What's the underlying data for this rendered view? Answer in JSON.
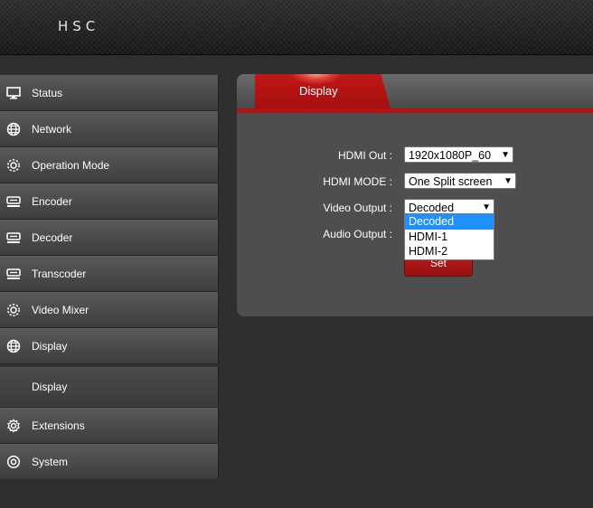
{
  "header": {
    "brand": "HSC"
  },
  "sidebar": {
    "items": [
      {
        "label": "Status",
        "icon": "monitor-icon"
      },
      {
        "label": "Network",
        "icon": "globe-icon"
      },
      {
        "label": "Operation Mode",
        "icon": "gear-icon"
      },
      {
        "label": "Encoder",
        "icon": "encoder-device-icon"
      },
      {
        "label": "Decoder",
        "icon": "decoder-device-icon"
      },
      {
        "label": "Transcoder",
        "icon": "transcoder-device-icon"
      },
      {
        "label": "Video Mixer",
        "icon": "gear-icon"
      },
      {
        "label": "Display",
        "icon": "globe-icon"
      }
    ],
    "subitems": [
      {
        "label": "Display"
      }
    ],
    "footer_items": [
      {
        "label": "Extensions",
        "icon": "cog-icon"
      },
      {
        "label": "System",
        "icon": "circle-target-icon"
      }
    ]
  },
  "panel": {
    "tab_label": "Display",
    "fields": [
      {
        "label": "HDMI Out :",
        "value": "1920x1080P_60"
      },
      {
        "label": "HDMI MODE :",
        "value": "One Split screen"
      },
      {
        "label": "Video Output :",
        "value": "Decoded"
      },
      {
        "label": "Audio Output :",
        "value": ""
      }
    ],
    "set_button": "Set",
    "video_output_options": [
      "Decoded",
      "HDMI-1",
      "HDMI-2"
    ],
    "video_output_highlighted": "Decoded"
  },
  "colors": {
    "accent": "#b01212",
    "highlight": "#1e90ff"
  }
}
